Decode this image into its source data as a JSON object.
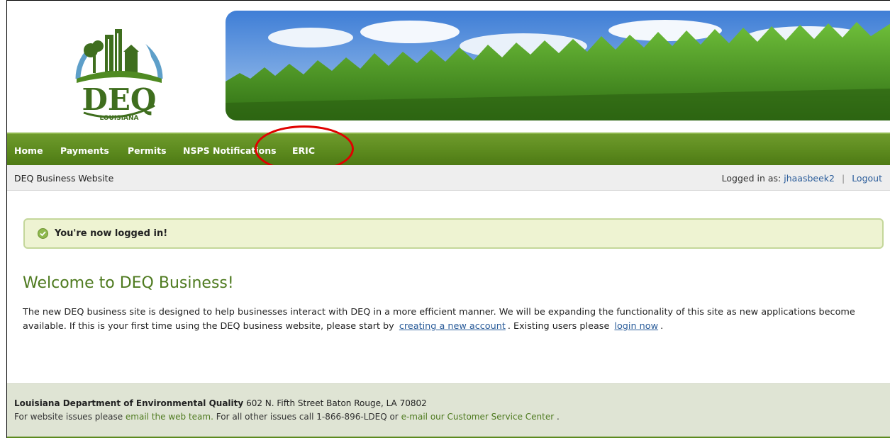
{
  "logo": {
    "text": "DEQ",
    "subtext": "LOUISIANA"
  },
  "nav": {
    "items": [
      {
        "label": "Home"
      },
      {
        "label": "Payments"
      },
      {
        "label": "Permits"
      },
      {
        "label": "NSPS Notifications"
      },
      {
        "label": "ERIC"
      }
    ]
  },
  "subbar": {
    "site_name": "DEQ Business Website",
    "logged_in_label": "Logged in as:",
    "username": "jhaasbeek2",
    "separator": "|",
    "logout": "Logout"
  },
  "alert": {
    "message": "You're now logged in!"
  },
  "main": {
    "title": "Welcome to DEQ Business!",
    "paragraph_part1": "The new DEQ business site is designed to help businesses interact with DEQ in a more efficient manner. We will be expanding the functionality of this site as new applications become available. If this is your first time using the DEQ business website, please start by",
    "create_account_link": "creating a new account",
    "paragraph_part2": ". Existing users please",
    "login_link": "login now",
    "paragraph_end": "."
  },
  "footer": {
    "org_name": "Louisiana Department of Environmental Quality",
    "address": "602 N. Fifth Street Baton Rouge, LA 70802",
    "issues_prefix": "For website issues please",
    "email_team_link": "email the web team.",
    "other_issues": "For all other issues call 1-866-896-LDEQ or",
    "customer_service_link": "e-mail our Customer Service Center",
    "end": "."
  },
  "colors": {
    "nav_green": "#5c8a1e",
    "title_green": "#4e7a1f",
    "link_blue": "#2a5c9a",
    "highlight_red": "#e00000"
  }
}
